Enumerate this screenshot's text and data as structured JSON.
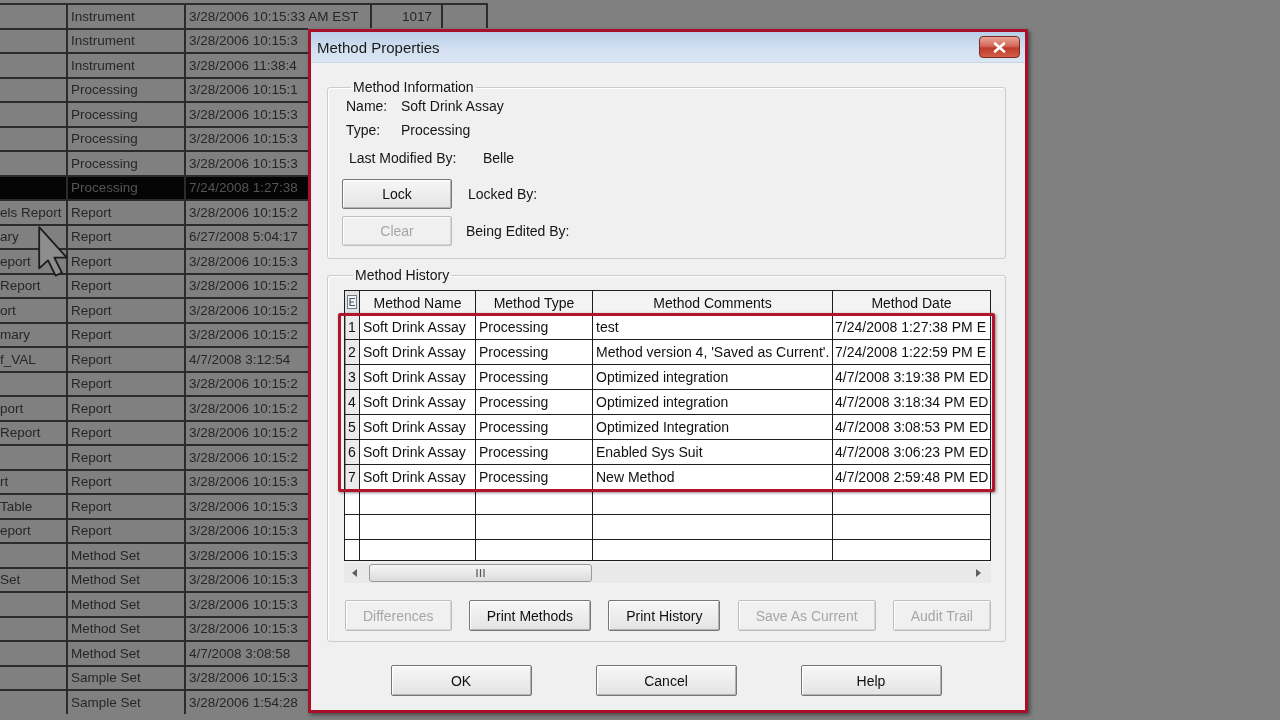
{
  "background_table": {
    "rows": [
      {
        "column_2": "Instrument",
        "column_3": "3/28/2006 10:15:33 AM EST",
        "column_4": "1017",
        "selected": false
      },
      {
        "column_2": "Instrument",
        "column_3": "3/28/2006 10:15:3",
        "selected": false
      },
      {
        "column_2": "Instrument",
        "column_3": "3/28/2006 11:38:4",
        "selected": false
      },
      {
        "column_2": "Processing",
        "column_3": "3/28/2006 10:15:1",
        "selected": false
      },
      {
        "column_2": "Processing",
        "column_3": "3/28/2006 10:15:3",
        "selected": false
      },
      {
        "column_2": "Processing",
        "column_3": "3/28/2006 10:15:3",
        "selected": false
      },
      {
        "column_2": "Processing",
        "column_3": "3/28/2006 10:15:3",
        "selected": false
      },
      {
        "column_2": "Processing",
        "column_3": "7/24/2008 1:27:38",
        "selected": true
      },
      {
        "column_1": "els Report",
        "column_2": "Report",
        "column_3": "3/28/2006 10:15:2",
        "selected": false
      },
      {
        "column_1": "ary",
        "column_2": "Report",
        "column_3": "6/27/2008 5:04:17",
        "selected": false
      },
      {
        "column_1": "eport",
        "column_2": "Report",
        "column_3": "3/28/2006 10:15:3",
        "selected": false
      },
      {
        "column_1": "Report",
        "column_2": "Report",
        "column_3": "3/28/2006 10:15:2",
        "selected": false
      },
      {
        "column_1": "ort",
        "column_2": "Report",
        "column_3": "3/28/2006 10:15:2",
        "selected": false
      },
      {
        "column_1": "mary",
        "column_2": "Report",
        "column_3": "3/28/2006 10:15:2",
        "selected": false
      },
      {
        "column_1": "f_VAL",
        "column_2": "Report",
        "column_3": "4/7/2008 3:12:54",
        "selected": false
      },
      {
        "column_2": "Report",
        "column_3": "3/28/2006 10:15:2",
        "selected": false
      },
      {
        "column_1": "port",
        "column_2": "Report",
        "column_3": "3/28/2006 10:15:2",
        "selected": false
      },
      {
        "column_1": "Report",
        "column_2": "Report",
        "column_3": "3/28/2006 10:15:2",
        "selected": false
      },
      {
        "column_2": "Report",
        "column_3": "3/28/2006 10:15:2",
        "selected": false
      },
      {
        "column_1": "rt",
        "column_2": "Report",
        "column_3": "3/28/2006 10:15:3",
        "selected": false
      },
      {
        "column_1": "Table",
        "column_2": "Report",
        "column_3": "3/28/2006 10:15:3",
        "selected": false
      },
      {
        "column_1": "eport",
        "column_2": "Report",
        "column_3": "3/28/2006 10:15:3",
        "selected": false
      },
      {
        "column_2": "Method Set",
        "column_3": "3/28/2006 10:15:3",
        "selected": false
      },
      {
        "column_1": "Set",
        "column_2": "Method Set",
        "column_3": "3/28/2006 10:15:3",
        "selected": false
      },
      {
        "column_2": "Method Set",
        "column_3": "3/28/2006 10:15:3",
        "selected": false
      },
      {
        "column_2": "Method Set",
        "column_3": "3/28/2006 10:15:3",
        "selected": false
      },
      {
        "column_2": "Method Set",
        "column_3": "4/7/2008 3:08:58",
        "selected": false
      },
      {
        "column_2": "Sample Set",
        "column_3": "3/28/2006 10:15:3",
        "selected": false
      },
      {
        "column_2": "Sample Set",
        "column_3": "3/28/2006 1:54:28",
        "selected": false
      }
    ]
  },
  "dialog": {
    "title": "Method Properties",
    "highlighted": true,
    "method_information": {
      "legend": "Method Information",
      "fields": [
        {
          "label": "Name:",
          "value": "Soft Drink Assay"
        },
        {
          "label": "Type:",
          "value": "Processing"
        },
        {
          "label": "Last Modified By:",
          "value": "Belle"
        }
      ],
      "actions": [
        {
          "button": "Lock",
          "disabled": false,
          "label": "Locked By:"
        },
        {
          "button": "Clear",
          "disabled": true,
          "label": "Being Edited By:"
        }
      ]
    },
    "method_history": {
      "legend": "Method History",
      "columns": [
        "Method Name",
        "Method Type",
        "Method Comments",
        "Method Date"
      ],
      "highlighted": true,
      "rows": [
        {
          "number": "1",
          "cells": [
            "Soft Drink Assay",
            "Processing",
            "test",
            "7/24/2008 1:27:38 PM E"
          ]
        },
        {
          "number": "2",
          "cells": [
            "Soft Drink Assay",
            "Processing",
            "Method version 4, 'Saved as Current'.",
            "7/24/2008 1:22:59 PM E"
          ]
        },
        {
          "number": "3",
          "cells": [
            "Soft Drink Assay",
            "Processing",
            "Optimized integration",
            "4/7/2008 3:19:38 PM ED"
          ]
        },
        {
          "number": "4",
          "cells": [
            "Soft Drink Assay",
            "Processing",
            "Optimized integration",
            "4/7/2008 3:18:34 PM ED"
          ]
        },
        {
          "number": "5",
          "cells": [
            "Soft Drink Assay",
            "Processing",
            "Optimized Integration",
            "4/7/2008 3:08:53 PM ED"
          ]
        },
        {
          "number": "6",
          "cells": [
            "Soft Drink Assay",
            "Processing",
            "Enabled Sys Suit",
            "4/7/2008 3:06:23 PM ED"
          ]
        },
        {
          "number": "7",
          "cells": [
            "Soft Drink Assay",
            "Processing",
            "New Method",
            "4/7/2008 2:59:48 PM ED"
          ]
        }
      ],
      "buttons": [
        {
          "label": "Differences",
          "disabled": true
        },
        {
          "label": "Print Methods",
          "disabled": false
        },
        {
          "label": "Print History",
          "disabled": false
        },
        {
          "label": "Save As Current",
          "disabled": true
        },
        {
          "label": "Audit Trail",
          "disabled": true
        }
      ]
    },
    "buttons": [
      {
        "label": "OK",
        "disabled": false
      },
      {
        "label": "Cancel",
        "disabled": false
      },
      {
        "label": "Help",
        "disabled": false
      }
    ]
  }
}
